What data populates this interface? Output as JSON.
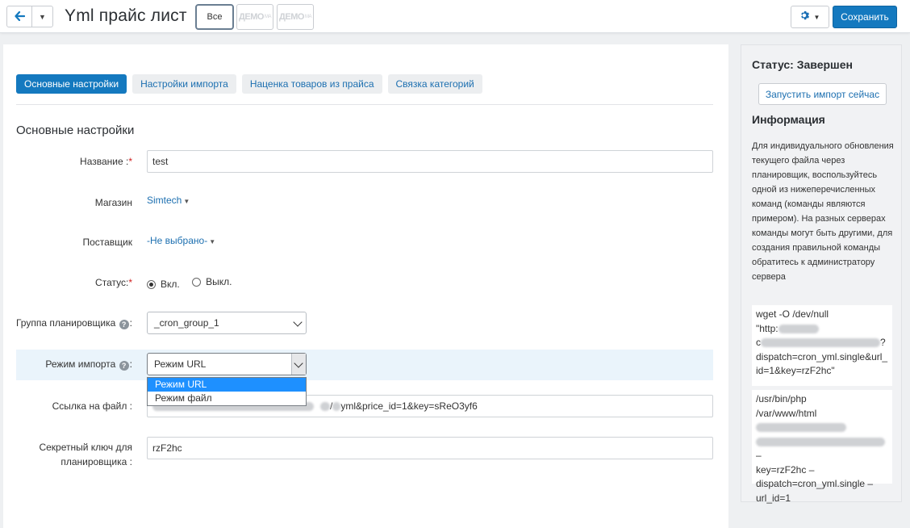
{
  "header": {
    "back_icon": "arrow-left-icon",
    "title": "Yml прайс лист",
    "stores": {
      "all": "Все",
      "demo1": "ДЕМО",
      "demo2": "ДЕМО",
      "demo_sup": "МА"
    },
    "gear_icon": "gear-icon",
    "save_label": "Сохранить"
  },
  "tabs": [
    {
      "label": "Основные настройки",
      "active": true
    },
    {
      "label": "Настройки импорта",
      "active": false
    },
    {
      "label": "Наценка товаров из прайса",
      "active": false
    },
    {
      "label": "Связка категорий",
      "active": false
    }
  ],
  "section_title": "Основные настройки",
  "form": {
    "name": {
      "label": "Название :",
      "required_mark": "*",
      "value": "test"
    },
    "store": {
      "label": "Магазин",
      "value": "Simtech"
    },
    "supplier": {
      "label": "Поставщик",
      "value": "-Не выбрано-"
    },
    "status": {
      "label": "Статус:",
      "required_mark": "*",
      "on_label": "Вкл.",
      "off_label": "Выкл.",
      "selected": "on"
    },
    "scheduler_group": {
      "label": "Группа планировщика",
      "colon": ":",
      "value": "_cron_group_1"
    },
    "import_mode": {
      "label": "Режим импорта",
      "colon": ":",
      "value": "Режим URL",
      "options": [
        "Режим URL",
        "Режим файл"
      ],
      "selected_index": 0
    },
    "file_link": {
      "label": "Ссылка на файл :",
      "value_visible": "yml&price_id=1&key=sReO3yf6",
      "partial_sep": "/"
    },
    "secret_key": {
      "label_line1": "Секретный ключ для",
      "label_line2": "планировщика :",
      "value": "rzF2hc"
    }
  },
  "sidebar": {
    "status_title": "Статус: Завершен",
    "run_button": "Запустить импорт сейчас",
    "info_title": "Информация",
    "info_text": "Для индивидуального обновления текущего файла через планировщик, воспользуйтесь одной из нижеперечисленных команд (команды являются примером). На разных серверах команды могут быть другими, для создания правильной команды обратитесь к администратору сервера",
    "cmd1": {
      "l1": "wget -O /dev/null",
      "l2": "\"http:",
      "l3a": "c",
      "l3b": "?",
      "l4": "dispatch=cron_yml.single&url_",
      "l5": "id=1&key=rzF2hc\""
    },
    "cmd2": {
      "l1": "/usr/bin/php",
      "l2": "/var/www/html",
      "l3": "–",
      "l4": "key=rzF2hc –",
      "l5": "dispatch=cron_yml.single –",
      "l6": "url_id=1"
    }
  },
  "colors": {
    "primary": "#1479bf",
    "link": "#1c6fb0",
    "highlight": "#eaf4fb",
    "dropdown_selected": "#1e90ff"
  }
}
